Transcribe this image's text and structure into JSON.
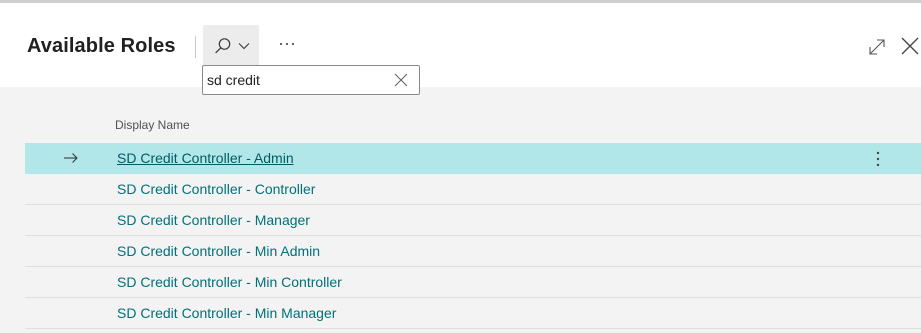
{
  "page": {
    "title": "Available Roles"
  },
  "search": {
    "value": "sd credit",
    "placeholder": ""
  },
  "icons": {
    "search_toggle": "search-icon",
    "search_dropdown": "chevron-down-icon",
    "more": "ellipsis-icon",
    "expand": "expand-icon",
    "close": "close-icon",
    "clear": "clear-search-icon",
    "selected_arrow": "arrow-right-icon",
    "row_menu": "vertical-ellipsis-icon"
  },
  "colors": {
    "selected_row": "#b2e7ea",
    "link": "#00707a",
    "content_bg": "#f3f3f3"
  },
  "grid": {
    "column_header": "Display Name",
    "selected_index": 0,
    "rows": [
      {
        "display_name": "SD Credit Controller - Admin"
      },
      {
        "display_name": "SD Credit Controller - Controller"
      },
      {
        "display_name": "SD Credit Controller - Manager"
      },
      {
        "display_name": "SD Credit Controller - Min Admin"
      },
      {
        "display_name": "SD Credit Controller - Min Controller"
      },
      {
        "display_name": "SD Credit Controller - Min Manager"
      }
    ]
  }
}
